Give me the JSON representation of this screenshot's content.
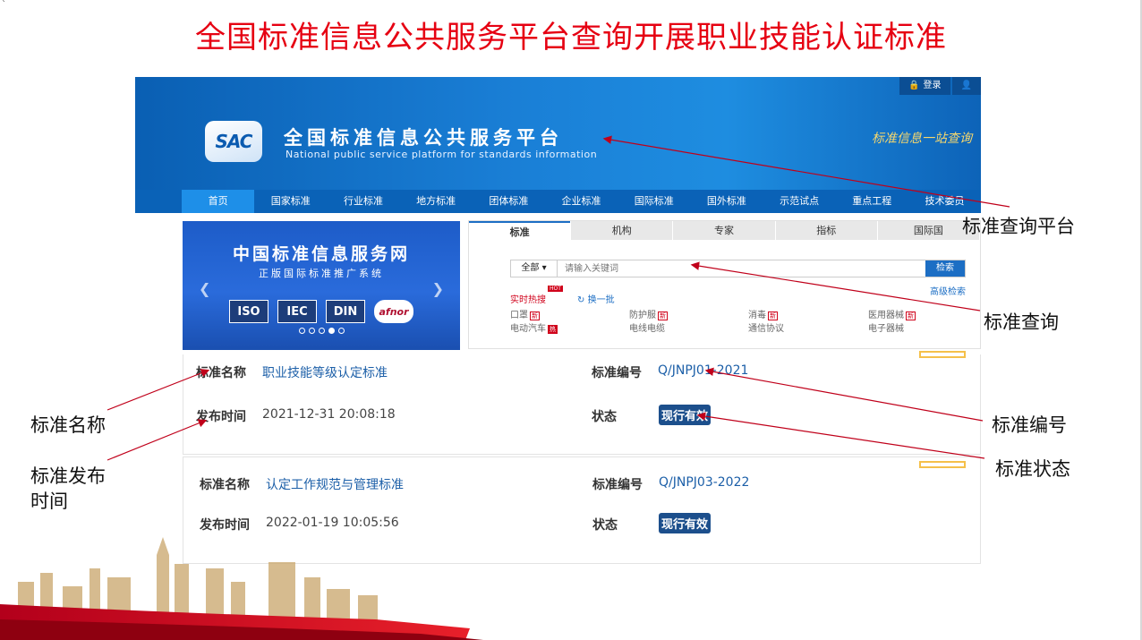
{
  "slide_title": "全国标准信息公共服务平台查询开展职业技能认证标准",
  "portal": {
    "topbar": {
      "login": "登录",
      "user_icon": "user-icon"
    },
    "logo_text": "SAC",
    "name_cn": "全国标准信息公共服务平台",
    "name_en": "National public service platform  for standards information",
    "slogan": "标准信息一站查询",
    "nav": [
      "首页",
      "国家标准",
      "行业标准",
      "地方标准",
      "团体标准",
      "企业标准",
      "国际标准",
      "国外标准",
      "示范试点",
      "重点工程",
      "技术委员"
    ]
  },
  "banner": {
    "title": "中国标准信息服务网",
    "subtitle": "正版国际标准推广系统",
    "orgs": [
      "ISO",
      "IEC",
      "DIN",
      "afnor"
    ]
  },
  "search": {
    "tabs": [
      "标准",
      "机构",
      "专家",
      "指标",
      "国际国"
    ],
    "scope": "全部 ▾",
    "placeholder": "请输入关键词",
    "button": "检索",
    "advanced": "高级检索",
    "hot_label": "实时热搜",
    "hot_badge": "HOT",
    "refresh": "换一批",
    "keywords": [
      {
        "text": "口罩",
        "tag": "新"
      },
      {
        "text": "防护服",
        "tag": "新"
      },
      {
        "text": "消毒",
        "tag": "新"
      },
      {
        "text": "医用器械",
        "tag": "新"
      },
      {
        "text": "电动汽车",
        "tag": "热"
      },
      {
        "text": "电线电缆",
        "tag": ""
      },
      {
        "text": "通信协议",
        "tag": ""
      },
      {
        "text": "电子器械",
        "tag": ""
      }
    ]
  },
  "records": [
    {
      "name_label": "标准名称",
      "name": "职业技能等级认定标准",
      "number_label": "标准编号",
      "number": "Q/JNPJ01-2021",
      "date_label": "发布时间",
      "date": "2021-12-31 20:08:18",
      "status_label": "状态",
      "status": "现行有效"
    },
    {
      "name_label": "标准名称",
      "name": "认定工作规范与管理标准",
      "number_label": "标准编号",
      "number": "Q/JNPJ03-2022",
      "date_label": "发布时间",
      "date": "2022-01-19 10:05:56",
      "status_label": "状态",
      "status": "现行有效"
    }
  ],
  "annotations": {
    "platform": "标准查询平台",
    "query": "标准查询",
    "name": "标准名称",
    "publish_time_line1": "标准发布",
    "publish_time_line2": "时间",
    "number": "标准编号",
    "status": "标准状态"
  },
  "colors": {
    "title_red": "#e60012",
    "portal_blue": "#1a7fd6",
    "nav_blue": "#0a62b7",
    "badge_blue": "#1c4f8c",
    "arrow_red": "#c0001a"
  }
}
